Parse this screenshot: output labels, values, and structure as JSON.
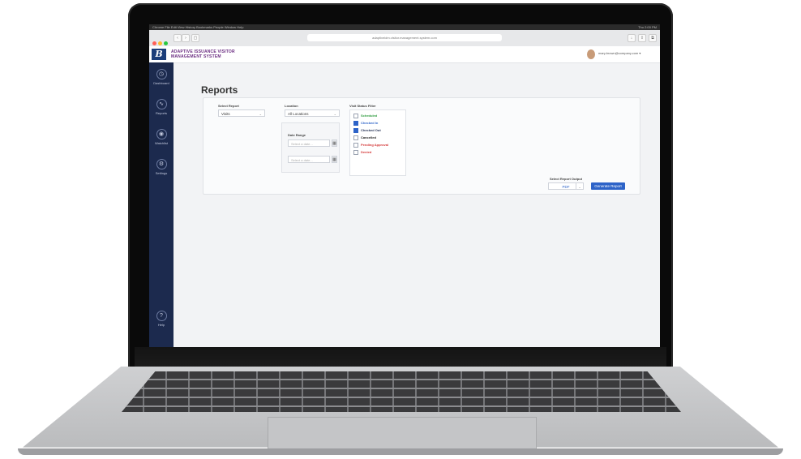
{
  "menubar": {
    "left": "Chrome  File  Edit  View  History  Bookmarks  People  Window  Help",
    "right": "Thu 2:00 PM"
  },
  "browser": {
    "url": "adaptiveidm.visitor.management.system.com"
  },
  "app": {
    "logo_text": "B",
    "brand_line1": "ADAPTIVE ISSUANCE VISITOR",
    "brand_line2": "MANAGEMENT SYSTEM",
    "user_email": "mary.brown@company.com"
  },
  "sidebar": {
    "items": [
      {
        "label": "Dashboard",
        "icon": "clock-icon"
      },
      {
        "label": "Reports",
        "icon": "chart-icon"
      },
      {
        "label": "Watchlist",
        "icon": "eye-icon"
      },
      {
        "label": "Settings",
        "icon": "gear-icon"
      }
    ],
    "help": {
      "label": "Help",
      "icon": "question-icon"
    }
  },
  "page": {
    "title": "Reports"
  },
  "form": {
    "select_report_label": "Select Report",
    "select_report_value": "Visits",
    "location_label": "Location",
    "location_value": "All Locations",
    "date_range_label": "Date Range",
    "date_from_placeholder": "Select a date...",
    "date_to_placeholder": "Select a date...",
    "visit_status_label": "Visit Status Filter",
    "statuses": [
      {
        "label": "Scheduled",
        "checked": false,
        "color": "#2e9b3e"
      },
      {
        "label": "Checked In",
        "checked": true,
        "color": "#2d63c8"
      },
      {
        "label": "Checked Out",
        "checked": true,
        "color": "#1c2a4e"
      },
      {
        "label": "Cancelled",
        "checked": false,
        "color": "#222222"
      },
      {
        "label": "Pending Approval",
        "checked": false,
        "color": "#d43a3a"
      },
      {
        "label": "Denied",
        "checked": false,
        "color": "#d43a3a"
      }
    ],
    "output_label": "Select Report Output",
    "output_value": "PDF",
    "generate_button": "Generate Report"
  },
  "colors": {
    "accent": "#2d63c8",
    "sidebar": "#1c2a4e",
    "brand": "#6b2d82"
  }
}
